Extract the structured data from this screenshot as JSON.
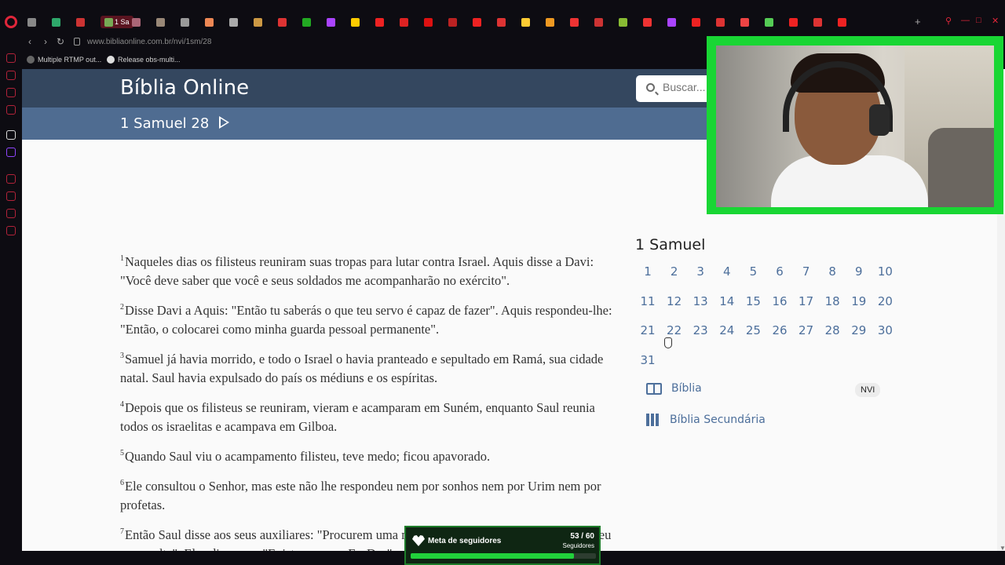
{
  "browser": {
    "active_tab_label": "1 Sa",
    "url": "www.bibliaonline.com.br/nvi/1sm/28",
    "bookmarks": [
      "Multiple RTMP out...",
      "Release obs-multi..."
    ]
  },
  "site": {
    "title": "Bíblia Online",
    "search_placeholder": "Buscar...",
    "chapter_title": "1 Samuel 28"
  },
  "verses": [
    {
      "num": "1",
      "text": "Naqueles dias os filisteus reuniram suas tropas para lutar contra Israel. Aquis disse a Davi: \"Você deve saber que você e seus soldados me acompanharão no exército\"."
    },
    {
      "num": "2",
      "text": "Disse Davi a Aquis: \"Então tu saberás o que teu servo é capaz de fazer\". Aquis respondeu-lhe: \"Então, o colocarei como minha guarda pessoal permanente\"."
    },
    {
      "num": "3",
      "text": "Samuel já havia morrido, e todo o Israel o havia pranteado e sepultado em Ramá, sua cidade natal. Saul havia expulsado do país os médiuns e os espíritas."
    },
    {
      "num": "4",
      "text": "Depois que os filisteus se reuniram, vieram e acamparam em Suném, enquanto Saul reunia todos os israelitas e acampava em Gilboa."
    },
    {
      "num": "5",
      "text": "Quando Saul viu o acampamento filisteu, teve medo; ficou apavorado."
    },
    {
      "num": "6",
      "text": "Ele consultou o Senhor, mas este não lhe respondeu nem por sonhos nem por Urim nem por profetas."
    },
    {
      "num": "7",
      "text": "Então Saul disse aos seus auxiliares: \"Procurem uma mulher que invoca espíritos, para que eu a consulte\". Eles disseram: \"Existe uma em En-Dor\"."
    }
  ],
  "book_panel": {
    "book_name": "1 Samuel",
    "chapters": [
      "1",
      "2",
      "3",
      "4",
      "5",
      "6",
      "7",
      "8",
      "9",
      "10",
      "11",
      "12",
      "13",
      "14",
      "15",
      "16",
      "17",
      "18",
      "19",
      "20",
      "21",
      "22",
      "23",
      "24",
      "25",
      "26",
      "27",
      "28",
      "29",
      "30",
      "31"
    ],
    "bible_link": "Bíblia",
    "version_badge": "NVI",
    "secondary_link": "Bíblia Secundária"
  },
  "follower_goal": {
    "label": "Meta de seguidores",
    "count": "53 / 60",
    "sub": "Seguidores",
    "progress": 0.883
  },
  "colors": {
    "header": "#34475f",
    "chapter_bar": "#4f6c91",
    "link": "#4d6f9b",
    "cam_border": "#19d634"
  }
}
